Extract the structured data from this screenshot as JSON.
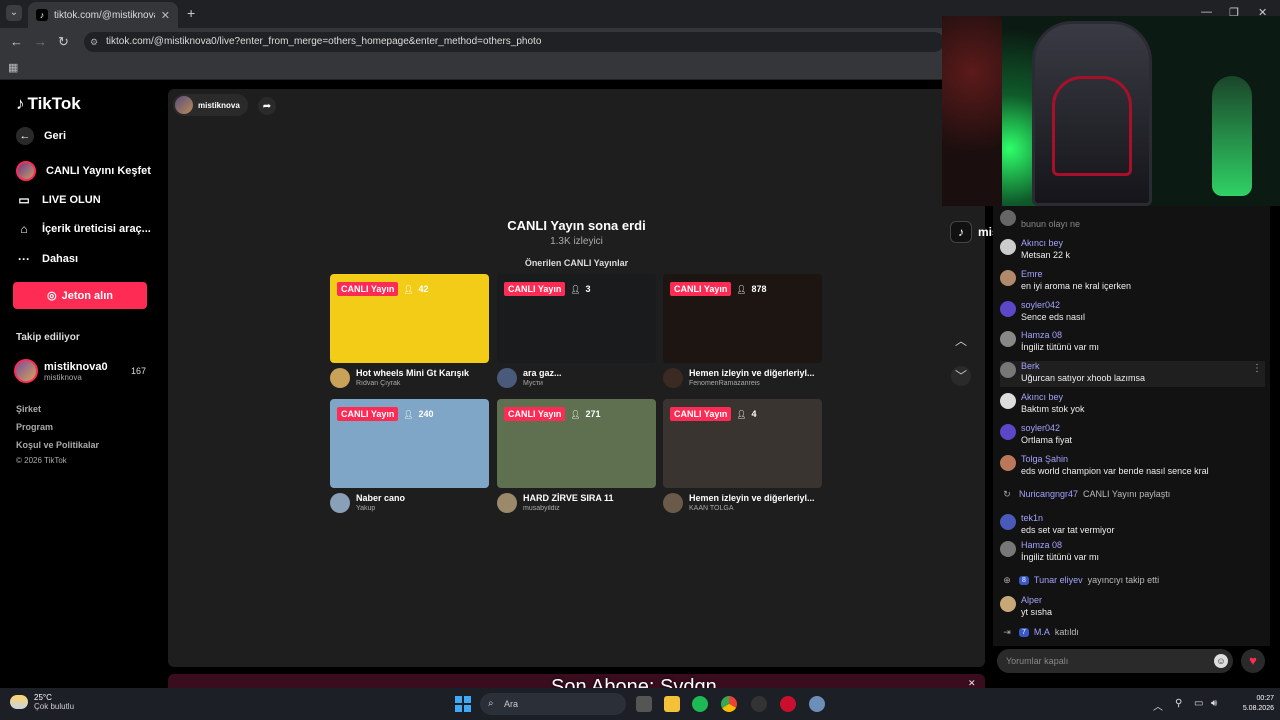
{
  "browser": {
    "tab_title": "tiktok.com/@mistiknova0/live?e",
    "url": "tiktok.com/@mistiknova0/live?enter_from_merge=others_homepage&enter_method=others_photo"
  },
  "sidebar": {
    "logo": "TikTok",
    "items": [
      {
        "label": "Geri"
      },
      {
        "label": "CANLI Yayını Keşfet"
      },
      {
        "label": "LIVE OLUN"
      },
      {
        "label": "İçerik üreticisi araç..."
      },
      {
        "label": "Dahası"
      }
    ],
    "coin_button": "Jeton alın",
    "following_title": "Takip ediliyor",
    "following": {
      "name": "mistiknova0",
      "handle": "mistiknova",
      "count": "167"
    },
    "footer": [
      "Şirket",
      "Program",
      "Koşul ve Politikalar",
      "© 2026 TikTok"
    ]
  },
  "main": {
    "host_name": "mistiknova",
    "ended_title": "CANLI Yayın sona erdi",
    "ended_viewers": "1.3K izleyici",
    "recommended_title": "Önerilen CANLI Yayınlar",
    "cards": [
      {
        "badge": "CANLI Yayın",
        "viewers": "42",
        "title": "Hot wheels Mini Gt Karışık",
        "user": "Rıdvan Çıyrak",
        "color": "#f2cc16"
      },
      {
        "badge": "CANLI Yayın",
        "viewers": "3",
        "title": "ara gaz...",
        "user": "Мусти",
        "color": "#1a1b1c"
      },
      {
        "badge": "CANLI Yayın",
        "viewers": "878",
        "title": "Hemen izleyin ve diğerleriyl...",
        "user": "FenomenRamazanreis",
        "color": "#1c1512"
      },
      {
        "badge": "CANLI Yayın",
        "viewers": "240",
        "title": "Naber cano",
        "user": "Yakup",
        "color": "#7fa6c6"
      },
      {
        "badge": "CANLI Yayın",
        "viewers": "271",
        "title": "HARD ZİRVE SIRA 11",
        "user": "musabyildiz",
        "color": "#5e7050"
      },
      {
        "badge": "CANLI Yayın",
        "viewers": "4",
        "title": "Hemen izleyin ve diğerleriyl...",
        "user": "KAAN TOLGA",
        "color": "#3a3430"
      }
    ]
  },
  "overlay": {
    "subscriber_text": "Son Abone: Svdgn"
  },
  "stream": {
    "username": "mistiknova0"
  },
  "chat": {
    "messages": [
      {
        "user": "",
        "text": "bunun olayı ne"
      },
      {
        "user": "Akıncı bey",
        "text": "Metsan 22 k"
      },
      {
        "user": "Emre",
        "text": "en iyi aroma ne kral içerken"
      },
      {
        "user": "soyler042",
        "text": "Sence eds nasıl"
      },
      {
        "user": "Hamza 08",
        "text": "İngiliz tütünü var mı"
      },
      {
        "user": "Berk",
        "text": "Uğurcan satıyor xhoob lazımsa"
      },
      {
        "user": "Akıncı bey",
        "text": "Baktım stok yok"
      },
      {
        "user": "soyler042",
        "text": "Ortlama fiyat"
      },
      {
        "user": "Tolga Şahin",
        "text": "eds world champion var bende nasıl sence kral"
      },
      {
        "user": "tek1n",
        "text": "eds set var tat vermiyor"
      },
      {
        "user": "Hamza 08",
        "text": "İngiliz tütünü var mı"
      },
      {
        "user": "Alper",
        "text": "yt sısha"
      }
    ],
    "system": [
      {
        "name": "Nuricangngr47",
        "text": "CANLI Yayını paylaştı",
        "level": ""
      },
      {
        "name": "Tunar eliyev",
        "text": "yayıncıyı takip etti",
        "level": "8"
      },
      {
        "name": "M.A",
        "text": "katıldı",
        "level": "7"
      }
    ],
    "input_placeholder": "Yorumlar kapalı"
  },
  "taskbar": {
    "temp": "25°C",
    "weather": "Çok bulutlu",
    "search": "Ara",
    "time": "00:27",
    "date": "5.08.2026"
  }
}
